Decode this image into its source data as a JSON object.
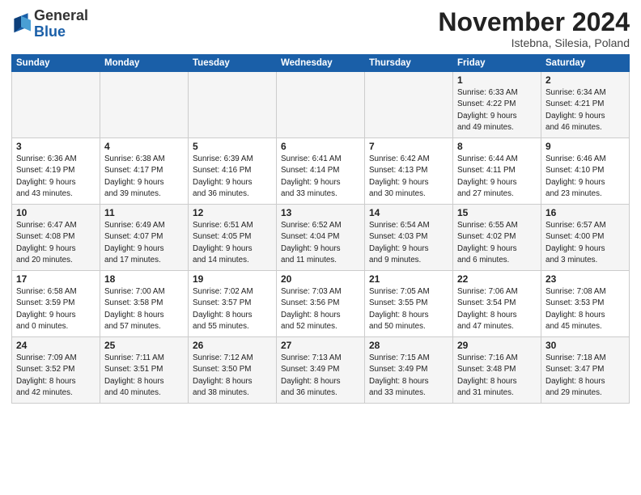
{
  "header": {
    "logo_general": "General",
    "logo_blue": "Blue",
    "month_title": "November 2024",
    "subtitle": "Istebna, Silesia, Poland"
  },
  "days_of_week": [
    "Sunday",
    "Monday",
    "Tuesday",
    "Wednesday",
    "Thursday",
    "Friday",
    "Saturday"
  ],
  "weeks": [
    [
      {
        "day": "",
        "info": ""
      },
      {
        "day": "",
        "info": ""
      },
      {
        "day": "",
        "info": ""
      },
      {
        "day": "",
        "info": ""
      },
      {
        "day": "",
        "info": ""
      },
      {
        "day": "1",
        "info": "Sunrise: 6:33 AM\nSunset: 4:22 PM\nDaylight: 9 hours\nand 49 minutes."
      },
      {
        "day": "2",
        "info": "Sunrise: 6:34 AM\nSunset: 4:21 PM\nDaylight: 9 hours\nand 46 minutes."
      }
    ],
    [
      {
        "day": "3",
        "info": "Sunrise: 6:36 AM\nSunset: 4:19 PM\nDaylight: 9 hours\nand 43 minutes."
      },
      {
        "day": "4",
        "info": "Sunrise: 6:38 AM\nSunset: 4:17 PM\nDaylight: 9 hours\nand 39 minutes."
      },
      {
        "day": "5",
        "info": "Sunrise: 6:39 AM\nSunset: 4:16 PM\nDaylight: 9 hours\nand 36 minutes."
      },
      {
        "day": "6",
        "info": "Sunrise: 6:41 AM\nSunset: 4:14 PM\nDaylight: 9 hours\nand 33 minutes."
      },
      {
        "day": "7",
        "info": "Sunrise: 6:42 AM\nSunset: 4:13 PM\nDaylight: 9 hours\nand 30 minutes."
      },
      {
        "day": "8",
        "info": "Sunrise: 6:44 AM\nSunset: 4:11 PM\nDaylight: 9 hours\nand 27 minutes."
      },
      {
        "day": "9",
        "info": "Sunrise: 6:46 AM\nSunset: 4:10 PM\nDaylight: 9 hours\nand 23 minutes."
      }
    ],
    [
      {
        "day": "10",
        "info": "Sunrise: 6:47 AM\nSunset: 4:08 PM\nDaylight: 9 hours\nand 20 minutes."
      },
      {
        "day": "11",
        "info": "Sunrise: 6:49 AM\nSunset: 4:07 PM\nDaylight: 9 hours\nand 17 minutes."
      },
      {
        "day": "12",
        "info": "Sunrise: 6:51 AM\nSunset: 4:05 PM\nDaylight: 9 hours\nand 14 minutes."
      },
      {
        "day": "13",
        "info": "Sunrise: 6:52 AM\nSunset: 4:04 PM\nDaylight: 9 hours\nand 11 minutes."
      },
      {
        "day": "14",
        "info": "Sunrise: 6:54 AM\nSunset: 4:03 PM\nDaylight: 9 hours\nand 9 minutes."
      },
      {
        "day": "15",
        "info": "Sunrise: 6:55 AM\nSunset: 4:02 PM\nDaylight: 9 hours\nand 6 minutes."
      },
      {
        "day": "16",
        "info": "Sunrise: 6:57 AM\nSunset: 4:00 PM\nDaylight: 9 hours\nand 3 minutes."
      }
    ],
    [
      {
        "day": "17",
        "info": "Sunrise: 6:58 AM\nSunset: 3:59 PM\nDaylight: 9 hours\nand 0 minutes."
      },
      {
        "day": "18",
        "info": "Sunrise: 7:00 AM\nSunset: 3:58 PM\nDaylight: 8 hours\nand 57 minutes."
      },
      {
        "day": "19",
        "info": "Sunrise: 7:02 AM\nSunset: 3:57 PM\nDaylight: 8 hours\nand 55 minutes."
      },
      {
        "day": "20",
        "info": "Sunrise: 7:03 AM\nSunset: 3:56 PM\nDaylight: 8 hours\nand 52 minutes."
      },
      {
        "day": "21",
        "info": "Sunrise: 7:05 AM\nSunset: 3:55 PM\nDaylight: 8 hours\nand 50 minutes."
      },
      {
        "day": "22",
        "info": "Sunrise: 7:06 AM\nSunset: 3:54 PM\nDaylight: 8 hours\nand 47 minutes."
      },
      {
        "day": "23",
        "info": "Sunrise: 7:08 AM\nSunset: 3:53 PM\nDaylight: 8 hours\nand 45 minutes."
      }
    ],
    [
      {
        "day": "24",
        "info": "Sunrise: 7:09 AM\nSunset: 3:52 PM\nDaylight: 8 hours\nand 42 minutes."
      },
      {
        "day": "25",
        "info": "Sunrise: 7:11 AM\nSunset: 3:51 PM\nDaylight: 8 hours\nand 40 minutes."
      },
      {
        "day": "26",
        "info": "Sunrise: 7:12 AM\nSunset: 3:50 PM\nDaylight: 8 hours\nand 38 minutes."
      },
      {
        "day": "27",
        "info": "Sunrise: 7:13 AM\nSunset: 3:49 PM\nDaylight: 8 hours\nand 36 minutes."
      },
      {
        "day": "28",
        "info": "Sunrise: 7:15 AM\nSunset: 3:49 PM\nDaylight: 8 hours\nand 33 minutes."
      },
      {
        "day": "29",
        "info": "Sunrise: 7:16 AM\nSunset: 3:48 PM\nDaylight: 8 hours\nand 31 minutes."
      },
      {
        "day": "30",
        "info": "Sunrise: 7:18 AM\nSunset: 3:47 PM\nDaylight: 8 hours\nand 29 minutes."
      }
    ]
  ]
}
